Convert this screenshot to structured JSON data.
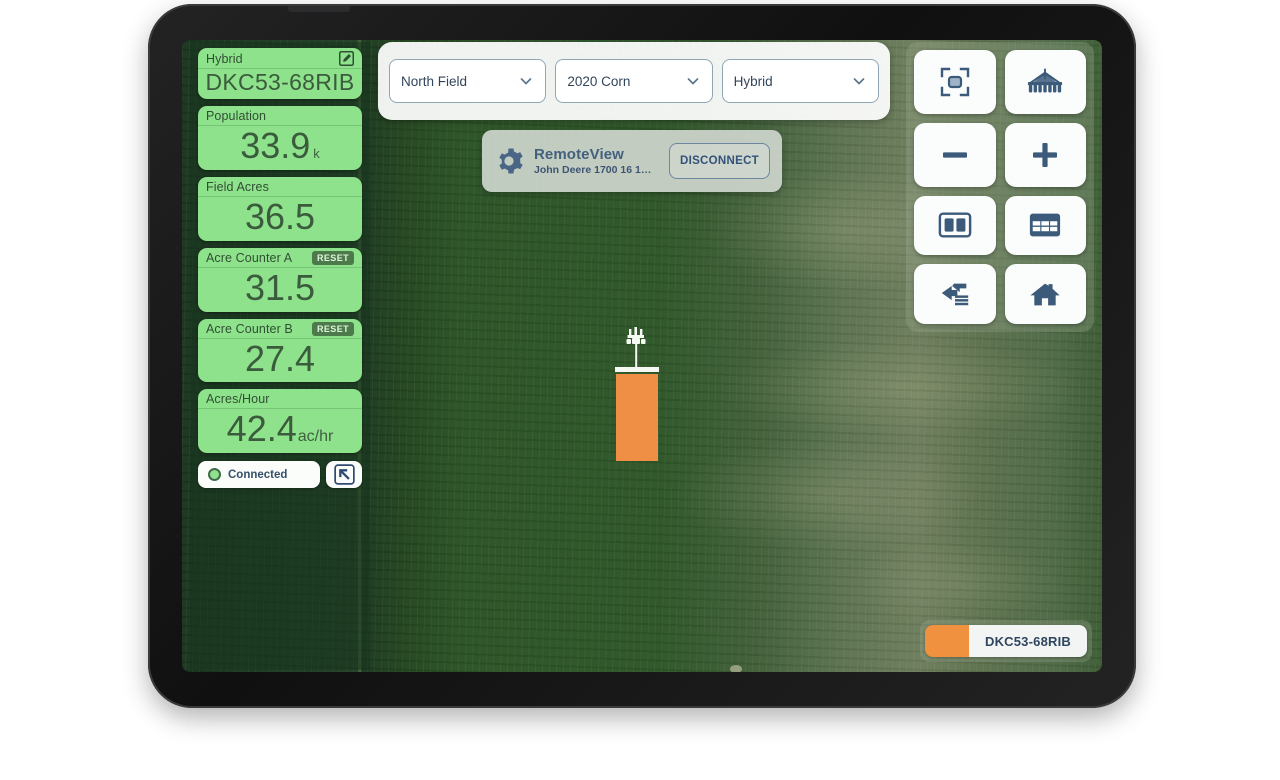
{
  "device": {
    "name": "tablet-frame"
  },
  "sidebar": {
    "cards": [
      {
        "label": "Hybrid",
        "value": "DKC53-68RIB",
        "unit": "",
        "action": "edit",
        "action_label": ""
      },
      {
        "label": "Population",
        "value": "33.9",
        "unit": "k",
        "action": "none",
        "action_label": ""
      },
      {
        "label": "Field Acres",
        "value": "36.5",
        "unit": "",
        "action": "none",
        "action_label": ""
      },
      {
        "label": "Acre Counter A",
        "value": "31.5",
        "unit": "",
        "action": "reset",
        "action_label": "RESET"
      },
      {
        "label": "Acre Counter B",
        "value": "27.4",
        "unit": "",
        "action": "reset",
        "action_label": "RESET"
      },
      {
        "label": "Acres/Hour",
        "value": "42.4",
        "unit": "ac/hr",
        "action": "none",
        "action_label": ""
      }
    ],
    "status": {
      "connection_text": "Connected",
      "connection_color": "#8fe28c",
      "expand_icon": "expand-arrow-icon"
    }
  },
  "top_bar": {
    "selects": [
      {
        "name": "field-select",
        "value": "North Field"
      },
      {
        "name": "season-select",
        "value": "2020 Corn"
      },
      {
        "name": "layer-select",
        "value": "Hybrid"
      }
    ]
  },
  "remote_view": {
    "icon": "gear-icon",
    "title": "RemoteView",
    "subtitle": "John Deere 1700 16 1…",
    "disconnect_label": "DISCONNECT"
  },
  "toolbar": {
    "buttons": [
      {
        "name": "fit-to-screen-button",
        "icon": "fit-screen-icon"
      },
      {
        "name": "implement-button",
        "icon": "planter-icon"
      },
      {
        "name": "zoom-out-button",
        "icon": "minus-icon"
      },
      {
        "name": "zoom-in-button",
        "icon": "plus-icon"
      },
      {
        "name": "split-view-button",
        "icon": "split-panel-icon"
      },
      {
        "name": "data-table-button",
        "icon": "table-grid-icon"
      },
      {
        "name": "swap-layer-button",
        "icon": "layers-swap-icon"
      },
      {
        "name": "home-button",
        "icon": "home-icon"
      }
    ]
  },
  "map": {
    "vehicle": {
      "icon": "tractor-icon",
      "applied_color": "#ef8f46"
    },
    "legend": {
      "swatch_color": "#f0913f",
      "label": "DKC53-68RIB"
    }
  },
  "colors": {
    "card_bg": "#8fe28c",
    "card_text": "#3a5b3c",
    "accent_blue": "#35506a",
    "applied_orange": "#ef8f46"
  }
}
